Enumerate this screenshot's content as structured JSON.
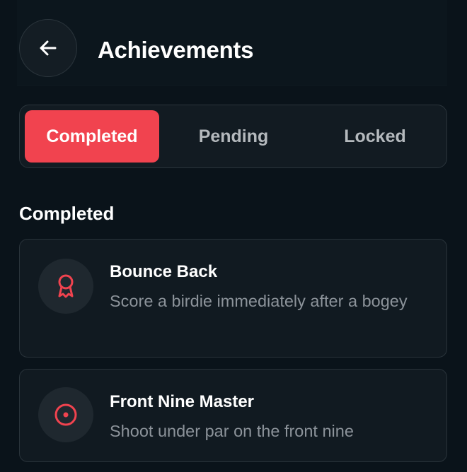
{
  "header": {
    "title": "Achievements",
    "back_icon": "arrow-left-icon"
  },
  "tabs": [
    {
      "label": "Completed",
      "active": true
    },
    {
      "label": "Pending",
      "active": false
    },
    {
      "label": "Locked",
      "active": false
    }
  ],
  "section": {
    "title": "Completed"
  },
  "achievements": [
    {
      "title": "Bounce Back",
      "description": "Score a birdie immediately after a bogey",
      "icon": "award-ribbon-icon"
    },
    {
      "title": "Front Nine Master",
      "description": "Shoot under par on the front nine",
      "icon": "target-icon"
    }
  ],
  "colors": {
    "accent": "#f1434f",
    "background": "#0a131a",
    "card": "#111a21",
    "muted_text": "#8c939a"
  }
}
